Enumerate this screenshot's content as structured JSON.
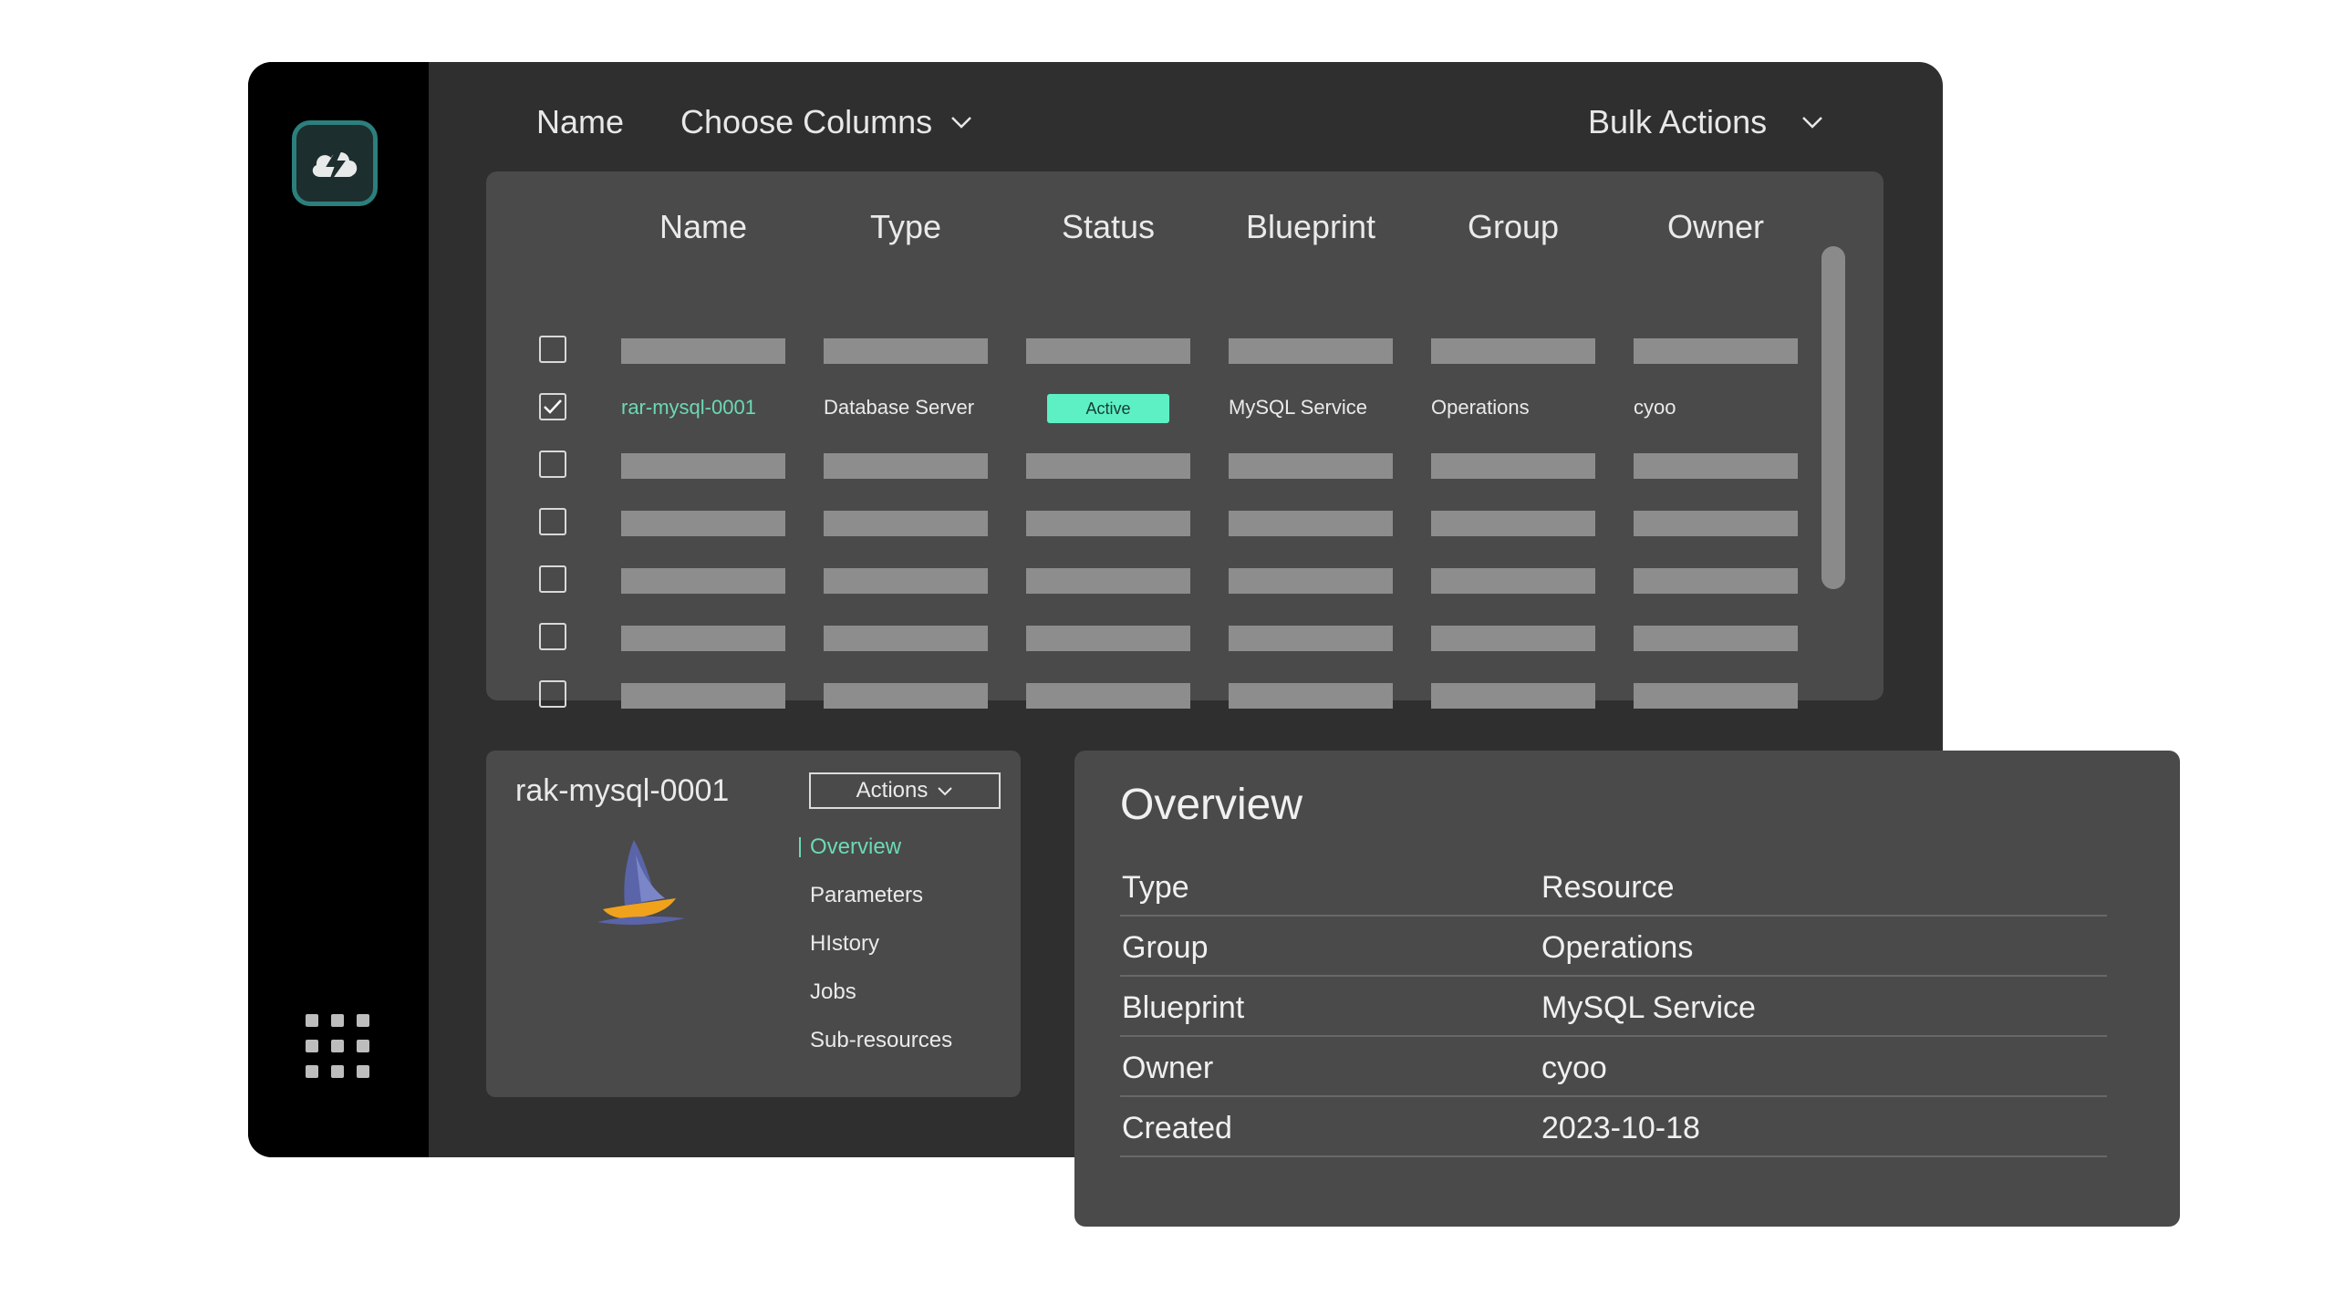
{
  "toolbar": {
    "name_label": "Name",
    "choose_columns_label": "Choose Columns",
    "bulk_actions_label": "Bulk Actions"
  },
  "table": {
    "columns": [
      "Name",
      "Type",
      "Status",
      "Blueprint",
      "Group",
      "Owner"
    ],
    "selected_row": {
      "name": "rar-mysql-0001",
      "type": "Database Server",
      "status": "Active",
      "blueprint": "MySQL Service",
      "group": "Operations",
      "owner": "cyoo"
    }
  },
  "detail": {
    "title": "rak-mysql-0001",
    "actions_label": "Actions",
    "nav": [
      "Overview",
      "Parameters",
      "HIstory",
      "Jobs",
      "Sub-resources"
    ]
  },
  "overview": {
    "title": "Overview",
    "rows": [
      {
        "key": "Type",
        "value": "Resource"
      },
      {
        "key": "Group",
        "value": "Operations"
      },
      {
        "key": "Blueprint",
        "value": "MySQL Service"
      },
      {
        "key": "Owner",
        "value": "cyoo"
      },
      {
        "key": "Created",
        "value": "2023-10-18"
      }
    ]
  },
  "colors": {
    "accent": "#6cd9b5",
    "status_active_bg": "#5df0c4",
    "panel_bg": "#4a4a4a",
    "app_bg": "#2f2f2f",
    "sidebar_bg": "#000000",
    "logo_teal": "#2c7f7c"
  },
  "icons": {
    "logo": "cloud-bolt-icon",
    "launcher": "app-grid-icon",
    "dropdown": "chevron-down-icon",
    "check": "checkmark-icon",
    "resource": "sailboat-icon"
  }
}
